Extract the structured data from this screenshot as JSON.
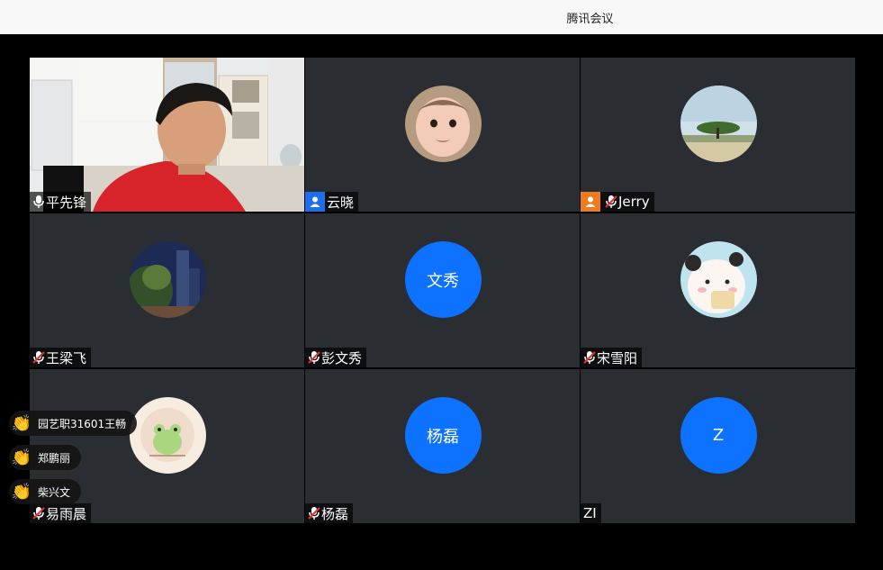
{
  "window": {
    "title": "腾讯会议"
  },
  "participants": [
    {
      "name": "平先锋",
      "mic": "on",
      "type": "video"
    },
    {
      "name": "云晓",
      "mic": "none",
      "type": "photo-baby",
      "badge": "blue-user"
    },
    {
      "name": "Jerry",
      "mic": "muted",
      "type": "photo-tree",
      "badge": "orange-user"
    },
    {
      "name": "王梁飞",
      "mic": "muted",
      "type": "photo-night"
    },
    {
      "name": "彭文秀",
      "mic": "muted",
      "type": "text",
      "avatar_text": "文秀"
    },
    {
      "name": "宋雪阳",
      "mic": "muted",
      "type": "photo-cartoon"
    },
    {
      "name": "易雨晨",
      "mic": "muted",
      "type": "photo-frog"
    },
    {
      "name": "杨磊",
      "mic": "muted",
      "type": "text",
      "avatar_text": "杨磊"
    },
    {
      "name": "ZI",
      "mic": "none",
      "type": "text",
      "avatar_text": "Z"
    }
  ],
  "raised_hands": [
    {
      "name": "园艺职31601王畅"
    },
    {
      "name": "郑鹏丽"
    },
    {
      "name": "柴兴文"
    }
  ],
  "colors": {
    "tile_bg": "#2a2d31",
    "avatar_blue": "#0d72ff",
    "active_outline": "#3fe08a"
  }
}
